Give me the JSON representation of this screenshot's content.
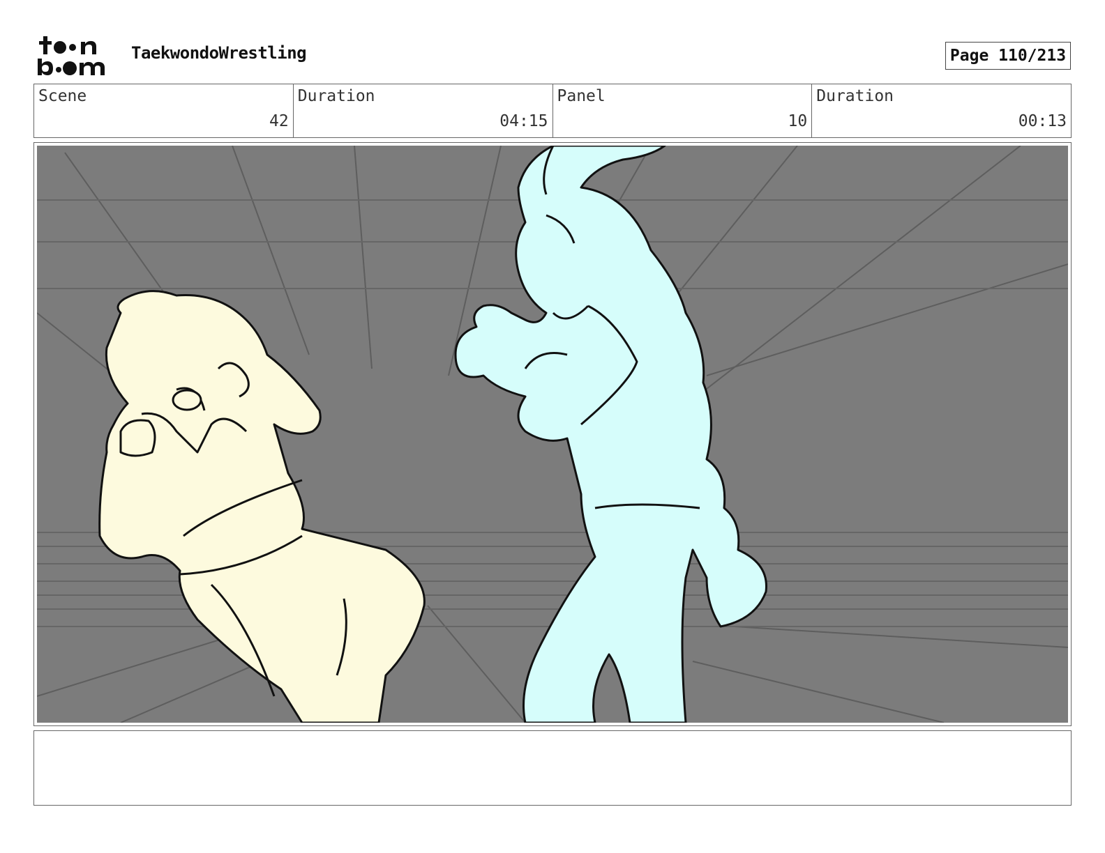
{
  "header": {
    "logo_icon": "toonboom-logo-icon",
    "project_title": "TaekwondoWrestling",
    "page_label": "Page 110/213"
  },
  "info": [
    {
      "label": "Scene",
      "value": "42"
    },
    {
      "label": "Duration",
      "value": "04:15"
    },
    {
      "label": "Panel",
      "value": "10"
    },
    {
      "label": "Duration",
      "value": "00:13"
    }
  ],
  "panel": {
    "background_color": "#7c7c7c",
    "left_character_color": "#fdfade",
    "right_character_color": "#d6fdfb"
  },
  "notes": {
    "text": ""
  }
}
